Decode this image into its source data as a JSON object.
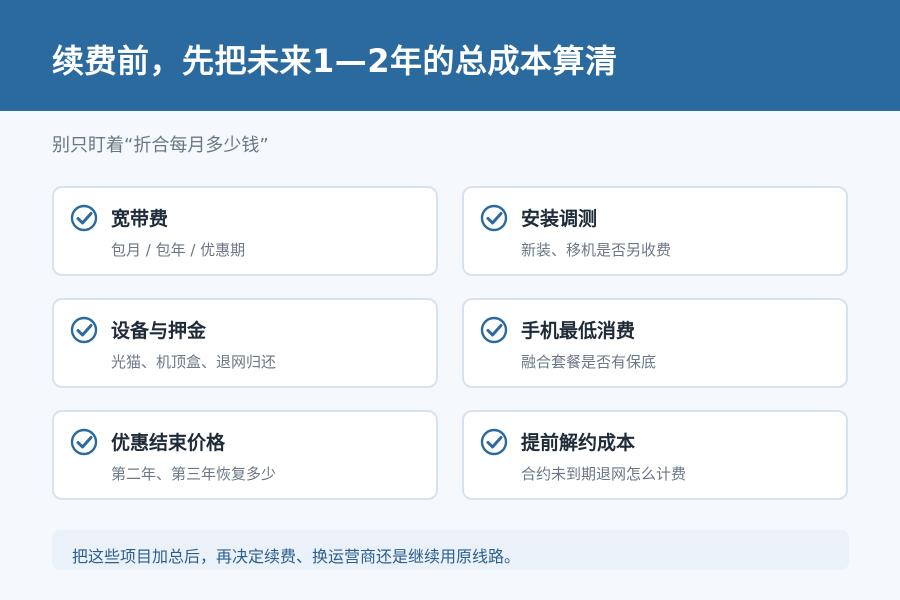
{
  "header": {
    "title": "续费前，先把未来1—2年的总成本算清",
    "background_color": "#2b6a9e"
  },
  "subtitle": "别只盯着“折合每月多少钱”",
  "accent_color": "#2b6a9e",
  "items": [
    {
      "label": "宽带费",
      "desc": "包月 / 包年 / 优惠期",
      "icon": "check-circle-icon"
    },
    {
      "label": "安装调测",
      "desc": "新装、移机是否另收费",
      "icon": "check-circle-icon"
    },
    {
      "label": "设备与押金",
      "desc": "光猫、机顶盒、退网归还",
      "icon": "check-circle-icon"
    },
    {
      "label": "手机最低消费",
      "desc": "融合套餐是否有保底",
      "icon": "check-circle-icon"
    },
    {
      "label": "优惠结束价格",
      "desc": "第二年、第三年恢复多少",
      "icon": "check-circle-icon"
    },
    {
      "label": "提前解约成本",
      "desc": "合约未到期退网怎么计费",
      "icon": "check-circle-icon"
    }
  ],
  "note": "把这些项目加总后，再决定续费、换运营商还是继续用原线路。"
}
